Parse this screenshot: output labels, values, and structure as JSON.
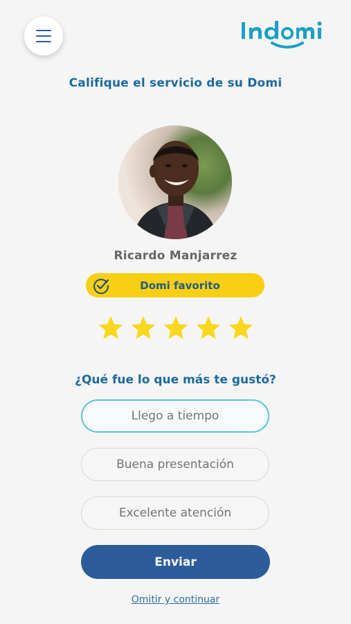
{
  "header": {
    "menu_icon": "hamburger-menu-icon",
    "logo_text": "Indomi",
    "logo_color": "#1aa0c8"
  },
  "page": {
    "title": "Califique el servicio de su Domi"
  },
  "driver": {
    "name": "Ricardo Manjarrez",
    "badge_label": "Domi favorito",
    "badge_icon": "check-circle-icon",
    "badge_color": "#f9cf12"
  },
  "rating": {
    "stars": 5,
    "max": 5,
    "star_color": "#f9d71c"
  },
  "feedback": {
    "question": "¿Qué fue lo que más te gustó?",
    "options": [
      {
        "label": "Llego a tiempo",
        "selected": true
      },
      {
        "label": "Buena presentación",
        "selected": false
      },
      {
        "label": "Excelente atención",
        "selected": false
      }
    ]
  },
  "actions": {
    "submit_label": "Enviar",
    "skip_label": "Omitir y continuar",
    "primary_color": "#2c5d9a"
  }
}
